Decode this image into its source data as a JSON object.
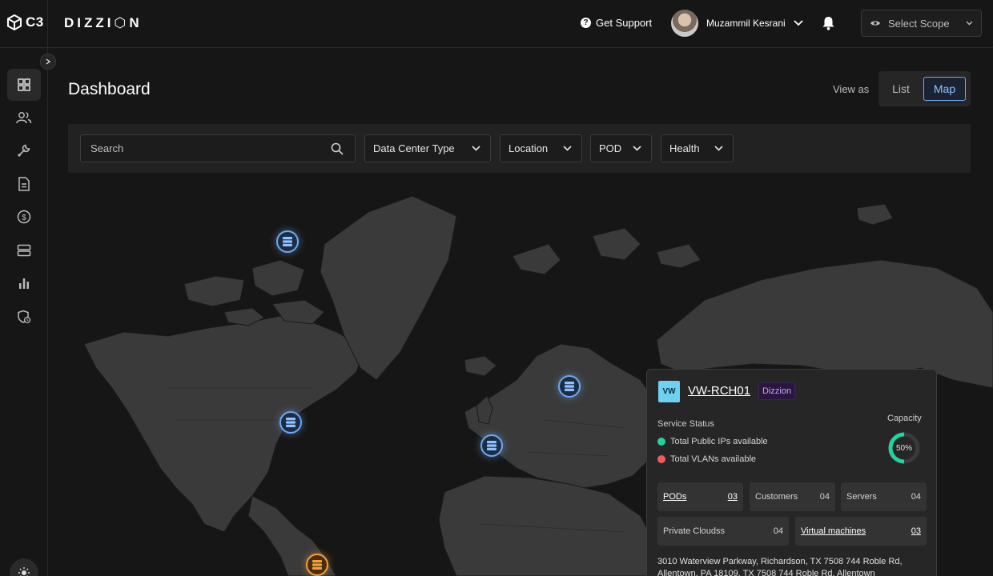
{
  "app": {
    "logo_text": "C3",
    "brand": "DIZZI⬡N"
  },
  "header": {
    "support_label": "Get Support",
    "user_name": "Muzammil Kesrani",
    "scope_placeholder": "Select Scope"
  },
  "sidebar": {
    "items": [
      {
        "icon": "dashboard-icon",
        "active": true
      },
      {
        "icon": "users-icon",
        "active": false
      },
      {
        "icon": "tools-icon",
        "active": false
      },
      {
        "icon": "document-icon",
        "active": false
      },
      {
        "icon": "billing-icon",
        "active": false
      },
      {
        "icon": "servers-icon",
        "active": false
      },
      {
        "icon": "reports-icon",
        "active": false
      },
      {
        "icon": "security-icon",
        "active": false
      }
    ]
  },
  "page": {
    "title": "Dashboard",
    "view_as_label": "View as",
    "view_options": [
      "List",
      "Map"
    ],
    "selected_view": "Map"
  },
  "filters": {
    "search_placeholder": "Search",
    "dropdowns": [
      "Data Center Type",
      "Location",
      "POD",
      "Health"
    ]
  },
  "map": {
    "pins": [
      {
        "status": "normal"
      },
      {
        "status": "normal"
      },
      {
        "status": "normal"
      },
      {
        "status": "normal"
      },
      {
        "status": "warning"
      }
    ]
  },
  "card": {
    "badge": "VW",
    "title": "VW-RCH01",
    "tag": "Dizzion",
    "service_status_label": "Service Status",
    "stats": [
      {
        "label": "Total Public IPs available",
        "color": "#22d3a0"
      },
      {
        "label": "Total VLANs available",
        "color": "#f25b5b"
      }
    ],
    "capacity_label": "Capacity",
    "capacity_value": "50%",
    "capacity_fraction": 0.5,
    "metrics": [
      {
        "label": "PODs",
        "value": "03",
        "link": true
      },
      {
        "label": "Customers",
        "value": "04",
        "link": false
      },
      {
        "label": "Servers",
        "value": "04",
        "link": false
      },
      {
        "label": "Private Cloudss",
        "value": "04",
        "link": false
      },
      {
        "label": "Virtual machines",
        "value": "03",
        "link": true
      }
    ],
    "address": "3010 Waterview Parkway, Richardson, TX 7508 744 Roble Rd, Allentown, PA 18109, TX 7508 744 Roble Rd, Allentown"
  },
  "colors": {
    "accent": "#6ea8f0",
    "warning": "#f0a13a",
    "success": "#22d3a0",
    "danger": "#f25b5b"
  }
}
